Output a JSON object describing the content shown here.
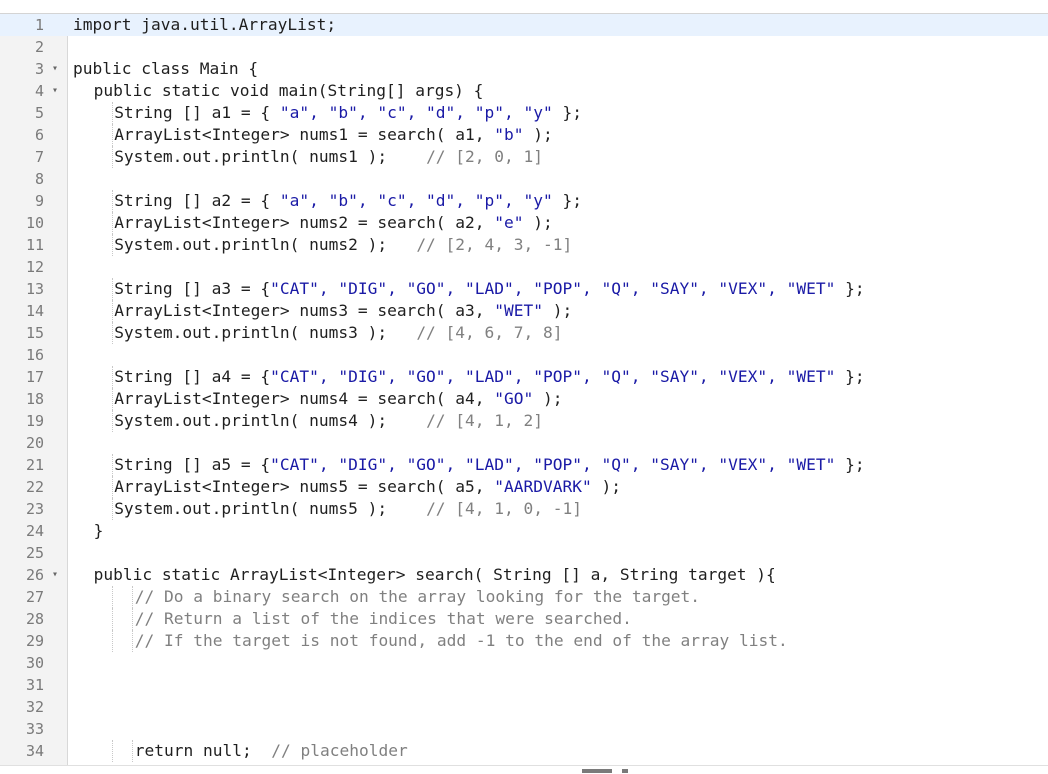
{
  "editor": {
    "lines": [
      {
        "n": "1",
        "fold": "",
        "indent": 0,
        "segments": [
          {
            "t": "import java.util.ArrayList;",
            "c": "type"
          }
        ]
      },
      {
        "n": "2",
        "fold": "",
        "indent": 0,
        "segments": []
      },
      {
        "n": "3",
        "fold": "▾",
        "indent": 0,
        "segments": [
          {
            "t": "public class Main {",
            "c": "type"
          }
        ]
      },
      {
        "n": "4",
        "fold": "▾",
        "indent": 1,
        "segments": [
          {
            "t": "public static void main(String[] args) {",
            "c": "type"
          }
        ]
      },
      {
        "n": "5",
        "fold": "",
        "indent": 2,
        "segments": [
          {
            "t": "String [] a1 = { ",
            "c": "type"
          },
          {
            "t": "\"a\", \"b\", \"c\", \"d\", \"p\", \"y\"",
            "c": "str"
          },
          {
            "t": " };",
            "c": "type"
          }
        ]
      },
      {
        "n": "6",
        "fold": "",
        "indent": 2,
        "segments": [
          {
            "t": "ArrayList<Integer> nums1 = search( a1, ",
            "c": "type"
          },
          {
            "t": "\"b\"",
            "c": "str"
          },
          {
            "t": " );",
            "c": "type"
          }
        ]
      },
      {
        "n": "7",
        "fold": "",
        "indent": 2,
        "segments": [
          {
            "t": "System.out.println( nums1 );    ",
            "c": "type"
          },
          {
            "t": "// [2, 0, 1]",
            "c": "cm"
          }
        ]
      },
      {
        "n": "8",
        "fold": "",
        "indent": 0,
        "segments": []
      },
      {
        "n": "9",
        "fold": "",
        "indent": 2,
        "segments": [
          {
            "t": "String [] a2 = { ",
            "c": "type"
          },
          {
            "t": "\"a\", \"b\", \"c\", \"d\", \"p\", \"y\"",
            "c": "str"
          },
          {
            "t": " };",
            "c": "type"
          }
        ]
      },
      {
        "n": "10",
        "fold": "",
        "indent": 2,
        "segments": [
          {
            "t": "ArrayList<Integer> nums2 = search( a2, ",
            "c": "type"
          },
          {
            "t": "\"e\"",
            "c": "str"
          },
          {
            "t": " );",
            "c": "type"
          }
        ]
      },
      {
        "n": "11",
        "fold": "",
        "indent": 2,
        "segments": [
          {
            "t": "System.out.println( nums2 );   ",
            "c": "type"
          },
          {
            "t": "// [2, 4, 3, -1]",
            "c": "cm"
          }
        ]
      },
      {
        "n": "12",
        "fold": "",
        "indent": 0,
        "segments": []
      },
      {
        "n": "13",
        "fold": "",
        "indent": 2,
        "segments": [
          {
            "t": "String [] a3 = {",
            "c": "type"
          },
          {
            "t": "\"CAT\", \"DIG\", \"GO\", \"LAD\", \"POP\", \"Q\", \"SAY\", \"VEX\", \"WET\"",
            "c": "str"
          },
          {
            "t": " };",
            "c": "type"
          }
        ]
      },
      {
        "n": "14",
        "fold": "",
        "indent": 2,
        "segments": [
          {
            "t": "ArrayList<Integer> nums3 = search( a3, ",
            "c": "type"
          },
          {
            "t": "\"WET\"",
            "c": "str"
          },
          {
            "t": " );",
            "c": "type"
          }
        ]
      },
      {
        "n": "15",
        "fold": "",
        "indent": 2,
        "segments": [
          {
            "t": "System.out.println( nums3 );   ",
            "c": "type"
          },
          {
            "t": "// [4, 6, 7, 8]",
            "c": "cm"
          }
        ]
      },
      {
        "n": "16",
        "fold": "",
        "indent": 0,
        "segments": []
      },
      {
        "n": "17",
        "fold": "",
        "indent": 2,
        "segments": [
          {
            "t": "String [] a4 = {",
            "c": "type"
          },
          {
            "t": "\"CAT\", \"DIG\", \"GO\", \"LAD\", \"POP\", \"Q\", \"SAY\", \"VEX\", \"WET\"",
            "c": "str"
          },
          {
            "t": " };",
            "c": "type"
          }
        ]
      },
      {
        "n": "18",
        "fold": "",
        "indent": 2,
        "segments": [
          {
            "t": "ArrayList<Integer> nums4 = search( a4, ",
            "c": "type"
          },
          {
            "t": "\"GO\"",
            "c": "str"
          },
          {
            "t": " );",
            "c": "type"
          }
        ]
      },
      {
        "n": "19",
        "fold": "",
        "indent": 2,
        "segments": [
          {
            "t": "System.out.println( nums4 );    ",
            "c": "type"
          },
          {
            "t": "// [4, 1, 2]",
            "c": "cm"
          }
        ]
      },
      {
        "n": "20",
        "fold": "",
        "indent": 0,
        "segments": []
      },
      {
        "n": "21",
        "fold": "",
        "indent": 2,
        "segments": [
          {
            "t": "String [] a5 = {",
            "c": "type"
          },
          {
            "t": "\"CAT\", \"DIG\", \"GO\", \"LAD\", \"POP\", \"Q\", \"SAY\", \"VEX\", \"WET\"",
            "c": "str"
          },
          {
            "t": " };",
            "c": "type"
          }
        ]
      },
      {
        "n": "22",
        "fold": "",
        "indent": 2,
        "segments": [
          {
            "t": "ArrayList<Integer> nums5 = search( a5, ",
            "c": "type"
          },
          {
            "t": "\"AARDVARK\"",
            "c": "str"
          },
          {
            "t": " );",
            "c": "type"
          }
        ]
      },
      {
        "n": "23",
        "fold": "",
        "indent": 2,
        "segments": [
          {
            "t": "System.out.println( nums5 );    ",
            "c": "type"
          },
          {
            "t": "// [4, 1, 0, -1]",
            "c": "cm"
          }
        ]
      },
      {
        "n": "24",
        "fold": "",
        "indent": 1,
        "segments": [
          {
            "t": "}",
            "c": "type"
          }
        ]
      },
      {
        "n": "25",
        "fold": "",
        "indent": 0,
        "segments": []
      },
      {
        "n": "26",
        "fold": "▾",
        "indent": 1,
        "segments": [
          {
            "t": "public static ArrayList<Integer> search( String [] a, String target ){",
            "c": "type"
          }
        ]
      },
      {
        "n": "27",
        "fold": "",
        "indent": 3,
        "segments": [
          {
            "t": "// Do a binary search on the array looking for the target.",
            "c": "cm"
          }
        ]
      },
      {
        "n": "28",
        "fold": "",
        "indent": 3,
        "segments": [
          {
            "t": "// Return a list of the indices that were searched.",
            "c": "cm"
          }
        ]
      },
      {
        "n": "29",
        "fold": "",
        "indent": 3,
        "segments": [
          {
            "t": "// If the target is not found, add -1 to the end of the array list.",
            "c": "cm"
          }
        ]
      },
      {
        "n": "30",
        "fold": "",
        "indent": 0,
        "segments": []
      },
      {
        "n": "31",
        "fold": "",
        "indent": 0,
        "segments": []
      },
      {
        "n": "32",
        "fold": "",
        "indent": 0,
        "segments": []
      },
      {
        "n": "33",
        "fold": "",
        "indent": 0,
        "segments": []
      },
      {
        "n": "34",
        "fold": "",
        "indent": 3,
        "segments": [
          {
            "t": "return null;  ",
            "c": "type"
          },
          {
            "t": "// placeholder",
            "c": "cm"
          }
        ]
      }
    ],
    "current_line": "1"
  }
}
